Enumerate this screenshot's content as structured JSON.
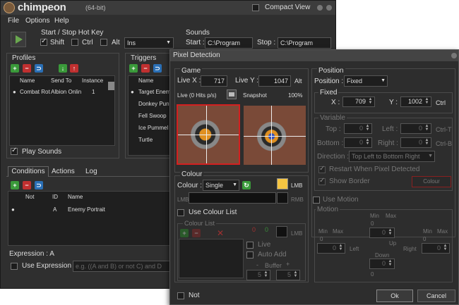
{
  "main": {
    "app": "chimpeon",
    "arch": "(64-bit)",
    "compact": "Compact View",
    "menu": [
      "File",
      "Options",
      "Help"
    ],
    "hotkey": {
      "title": "Start / Stop Hot Key",
      "shift": "Shift",
      "ctrl": "Ctrl",
      "alt": "Alt",
      "key": "Ins"
    },
    "sounds": {
      "title": "Sounds",
      "start_lbl": "Start :",
      "start": "C:\\Program",
      "stop_lbl": "Stop :",
      "stop": "C:\\Program"
    },
    "profiles": {
      "title": "Profiles",
      "cols": [
        "Name",
        "Send To",
        "Instance"
      ],
      "row": {
        "name": "Combat Rot",
        "send": "Albion Onlin",
        "inst": "1"
      },
      "play_sounds": "Play Sounds"
    },
    "triggers": {
      "title": "Triggers",
      "col": "Name",
      "rows": [
        "Target Enem",
        "Donkey Punc",
        "Fell Swoop",
        "Ice Pummel",
        "Turtle"
      ]
    },
    "tabs": [
      "Conditions",
      "Actions",
      "Log"
    ],
    "cond": {
      "cols": [
        "Not",
        "ID",
        "Name"
      ],
      "row": {
        "id": "A",
        "name": "Enemy Portrait"
      },
      "expr": "Expression : A",
      "use_expr": "Use Expression :",
      "expr_ph": "e.g. ((A and B) or not C) and D"
    }
  },
  "dlg": {
    "title": "Pixel Detection",
    "game": {
      "title": "Game",
      "livex_lbl": "Live X :",
      "livex": "717",
      "livey_lbl": "Live Y :",
      "livey": "1047",
      "alt": "Alt",
      "live_info": "Live (0 Hits p/s)",
      "snapshot": "Snapshot",
      "zoom": "100%"
    },
    "colour": {
      "title": "Colour",
      "lbl": "Colour :",
      "mode": "Single",
      "lmb": "LMB",
      "rmb": "RMB",
      "use_list": "Use Colour List",
      "list_title": "Colour List",
      "zero1": "0",
      "zero2": "0",
      "live": "Live",
      "auto_add": "Auto Add",
      "buffer": "Buffer",
      "minus": "-",
      "plus": "+",
      "b1": "5",
      "b2": "5"
    },
    "position": {
      "title": "Position",
      "lbl": "Position :",
      "mode": "Fixed",
      "fixed": "Fixed",
      "x_lbl": "X :",
      "x": "709",
      "y_lbl": "Y :",
      "y": "1002",
      "ctrl": "Ctrl"
    },
    "variable": {
      "title": "Variable",
      "top": "Top :",
      "left": "Left :",
      "bottom": "Bottom :",
      "right": "Right :",
      "top_v": "0",
      "left_v": "0",
      "bottom_v": "0",
      "right_v": "0",
      "ctrl_t": "Ctrl-T",
      "ctrl_b": "Ctrl-B",
      "dir_lbl": "Direction :",
      "dir": "Top Left to Bottom Right",
      "restart": "Restart When Pixel Detected",
      "show_border": "Show Border",
      "colour_btn": "Colour"
    },
    "motion": {
      "use": "Use Motion",
      "title": "Motion",
      "min": "Min",
      "max": "Max",
      "zero": "0",
      "up": "Up",
      "down": "Down",
      "left": "Left",
      "right": "Right"
    },
    "not": "Not",
    "ok": "Ok",
    "cancel": "Cancel"
  },
  "colors": {
    "accent": "#f5c542",
    "selected_border": "#d42020"
  }
}
